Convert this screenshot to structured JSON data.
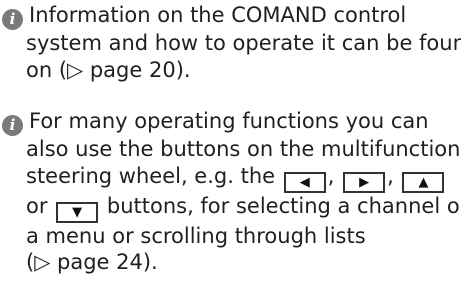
{
  "note1": {
    "icon": "info-icon",
    "lines": [
      "Information on the COMAND control",
      "system and how to operate it can be found",
      "on (▷ page 20)."
    ]
  },
  "note2": {
    "icon": "info-icon",
    "line1": "For many operating functions you can",
    "line2": "also use the buttons on the multifunction",
    "line3_prefix": "steering wheel, e.g. the",
    "sep1": ",",
    "sep2": ",",
    "line4_prefix": "or",
    "line4_suffix": "buttons, for selecting a channel or",
    "line5": "a menu or scrolling through lists",
    "line6": "(▷ page 24).",
    "buttons": {
      "left": "◀",
      "right": "▶",
      "up": "▲",
      "down": "▼"
    }
  }
}
